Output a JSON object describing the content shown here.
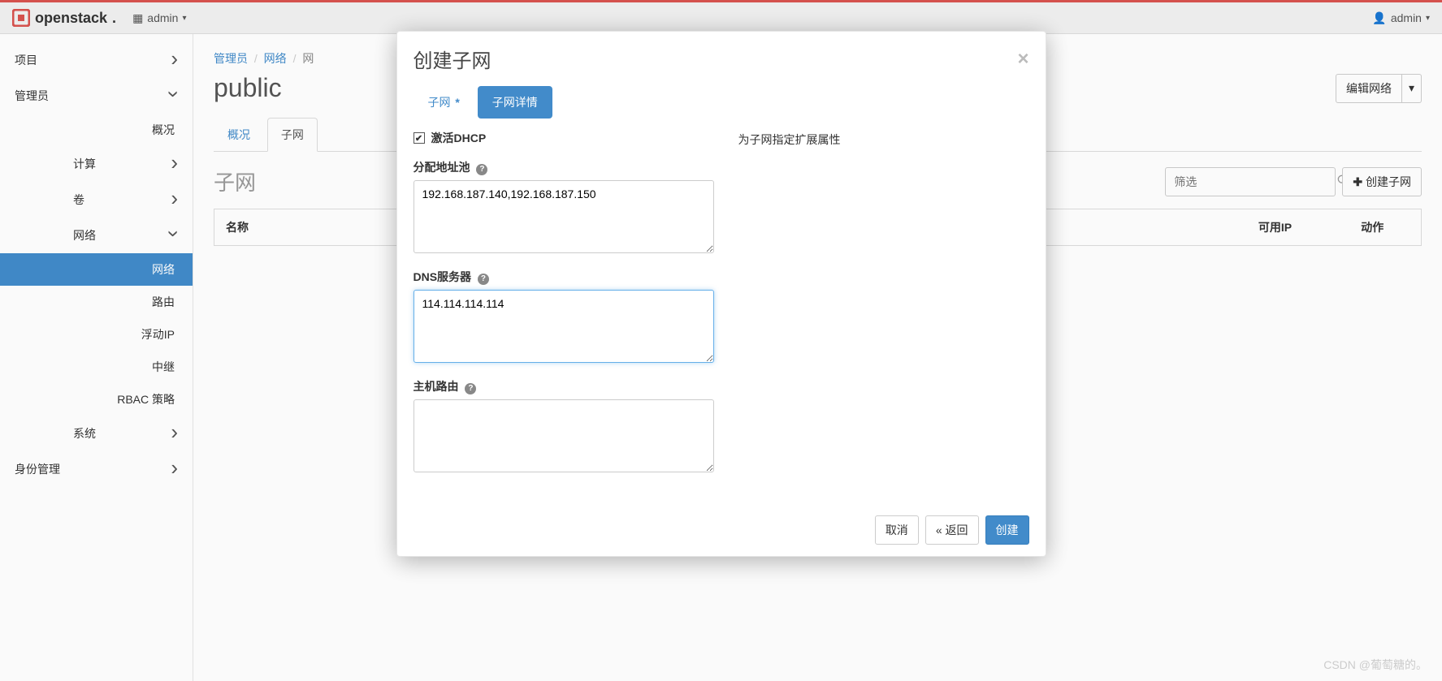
{
  "topbar": {
    "brand": "openstack",
    "project_label": "admin",
    "user_label": "admin"
  },
  "sidebar": {
    "project": "项目",
    "admin": "管理员",
    "overview": "概况",
    "compute": "计算",
    "volume": "卷",
    "network": "网络",
    "networks": "网络",
    "routers": "路由",
    "floatingips": "浮动IP",
    "relay": "中继",
    "rbac": "RBAC 策略",
    "system": "系统",
    "identity": "身份管理"
  },
  "breadcrumb": {
    "a": "管理员",
    "b": "网络",
    "c": "网"
  },
  "page": {
    "title": "public",
    "edit_btn": "编辑网络",
    "tabs": {
      "overview": "概况",
      "subnets": "子网"
    },
    "section": "子网",
    "filter_placeholder": "筛选",
    "create_btn": "创建子网",
    "cols": {
      "name": "名称",
      "ips": "可用IP",
      "actions": "动作"
    }
  },
  "modal": {
    "title": "创建子网",
    "tab_subnet": "子网",
    "tab_details": "子网详情",
    "hint": "为子网指定扩展属性",
    "dhcp_label": "激活DHCP",
    "alloc_label": "分配地址池",
    "alloc_value": "192.168.187.140,192.168.187.150",
    "dns_label": "DNS服务器",
    "dns_value": "114.114.114.114",
    "hostroutes_label": "主机路由",
    "hostroutes_value": "",
    "cancel": "取消",
    "back": "«  返回",
    "submit": "创建"
  },
  "watermark": "CSDN @葡萄糖的。"
}
